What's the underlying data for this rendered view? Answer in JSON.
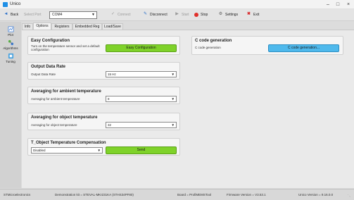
{
  "window": {
    "title": "Unico"
  },
  "toolbar": {
    "back": "Back",
    "select_port": "Select Port",
    "port_value": "COM4",
    "connect": "Connect",
    "disconnect": "Disconnect",
    "start": "Start",
    "stop": "Stop",
    "settings": "Settings",
    "exit": "Exit"
  },
  "sidebar": {
    "items": [
      {
        "label": "Plot"
      },
      {
        "label": "Algorithms"
      },
      {
        "label": "Tuning"
      }
    ]
  },
  "tabs": [
    {
      "label": "Info"
    },
    {
      "label": "Options"
    },
    {
      "label": "Registers"
    },
    {
      "label": "Embedded Reg"
    },
    {
      "label": "Load/Save"
    }
  ],
  "easy_config": {
    "title": "Easy Configuration",
    "desc_line1": "Turn on the temperature sensor and set a default",
    "desc_line2": "configuration",
    "button": "Easy Configuration"
  },
  "output_data_rate": {
    "title": "Output Data Rate",
    "label": "Output Data Rate",
    "value": "15 Hz"
  },
  "avg_ambient": {
    "title": "Averaging for ambient temperature",
    "label": "Averaging for ambient temperature",
    "value": "8"
  },
  "avg_object": {
    "title": "Averaging for object temperature",
    "label": "Averaging for object temperature",
    "value": "32"
  },
  "tobject_comp": {
    "title": "T_Object Temperature Compensation",
    "value": "Disabled",
    "button": "Send"
  },
  "c_code": {
    "title": "C code generation",
    "label": "C code generation",
    "button": "C code generation..."
  },
  "status": {
    "company": "STMicroelectronics",
    "demo_kit": "Demonstration kit = STEVAL-MKI231KA (STHS34PF80)",
    "board": "Board = ProfiMEMSTool",
    "firmware": "Firmware Version = V3.53.1",
    "unico": "Unico Version = 9.16.0.0"
  },
  "colors": {
    "green_button": "#7fd22a",
    "blue_button": "#4fb9ec",
    "stop_red": "#e0302a",
    "exit_red": "#d8282a"
  }
}
